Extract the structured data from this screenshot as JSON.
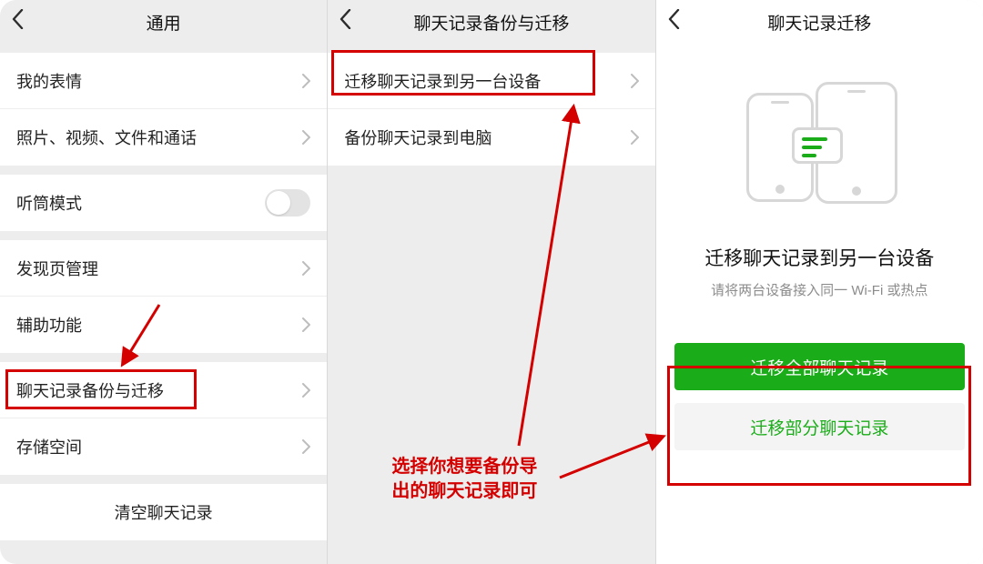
{
  "panel1": {
    "title": "通用",
    "items": {
      "stickers": "我的表情",
      "media": "照片、视频、文件和通话",
      "earpiece": "听筒模式",
      "discover": "发现页管理",
      "assist": "辅助功能",
      "backup": "聊天记录备份与迁移",
      "storage": "存储空间",
      "clear": "清空聊天记录"
    }
  },
  "panel2": {
    "title": "聊天记录备份与迁移",
    "items": {
      "migrate": "迁移聊天记录到另一台设备",
      "backup_pc": "备份聊天记录到电脑"
    },
    "note_line1": "选择你想要备份导",
    "note_line2": "出的聊天记录即可"
  },
  "panel3": {
    "title": "聊天记录迁移",
    "heading": "迁移聊天记录到另一台设备",
    "sub": "请将两台设备接入同一 Wi-Fi 或热点",
    "btn_all": "迁移全部聊天记录",
    "btn_some": "迁移部分聊天记录"
  }
}
